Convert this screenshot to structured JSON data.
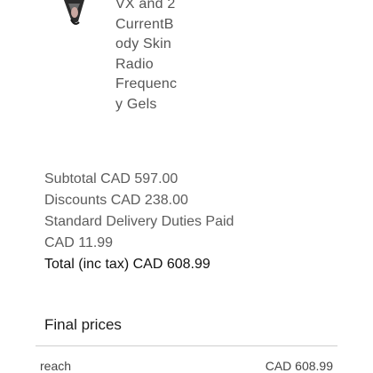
{
  "product": {
    "image_icon": "product-thumbnail",
    "name": "VX and 2\nCurrentB\nody Skin\nRadio\nFrequenc\ny Gels"
  },
  "summary": {
    "subtotal": "Subtotal CAD 597.00",
    "discounts": "Discounts CAD 238.00",
    "delivery_label": "Standard Delivery Duties Paid",
    "delivery_amount": "CAD 11.99",
    "total": "Total (inc tax) CAD 608.99"
  },
  "final_prices": {
    "title": "Final prices",
    "rows": [
      {
        "label": "reach",
        "value": "CAD 608.99"
      }
    ]
  }
}
